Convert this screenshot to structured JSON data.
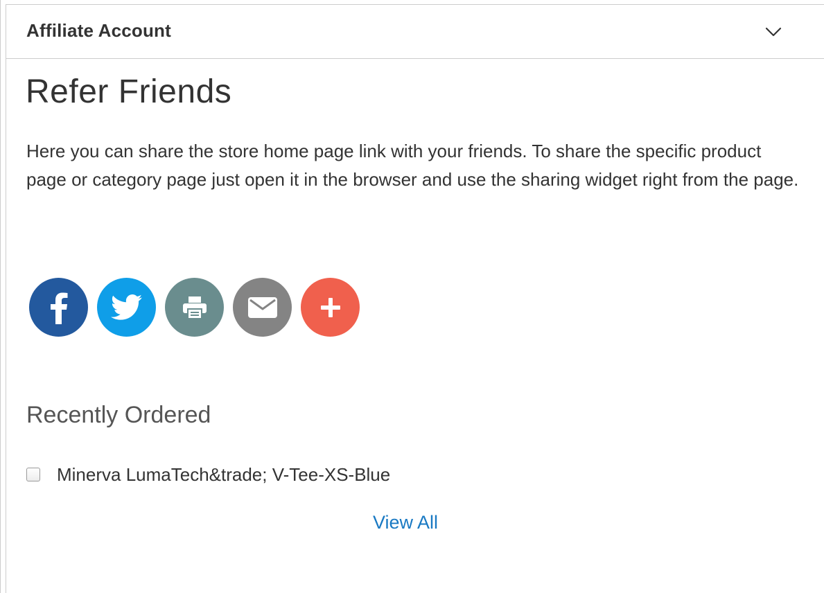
{
  "account_header": {
    "title": "Affiliate Account",
    "toggle_icon": "chevron-down-icon"
  },
  "main": {
    "title": "Refer Friends",
    "description": "Here you can share the store home page link with your friends. To share the specific product page or category page just open it in the browser and use the sharing widget right from the page."
  },
  "share_buttons": [
    {
      "name": "facebook",
      "icon": "facebook-icon",
      "color": "#23599e"
    },
    {
      "name": "twitter",
      "icon": "twitter-icon",
      "color": "#0f9ee8"
    },
    {
      "name": "print",
      "icon": "printer-icon",
      "color": "#6a8d8e"
    },
    {
      "name": "email",
      "icon": "envelope-icon",
      "color": "#848484"
    },
    {
      "name": "more",
      "icon": "plus-icon",
      "color": "#f0604d"
    }
  ],
  "recently_ordered": {
    "title": "Recently Ordered",
    "items": [
      {
        "label": "Minerva LumaTech&trade; V-Tee-XS-Blue",
        "checked": false
      }
    ],
    "view_all_label": "View All"
  },
  "colors": {
    "link": "#1979c3",
    "border": "#cccccc",
    "text": "#333333"
  }
}
